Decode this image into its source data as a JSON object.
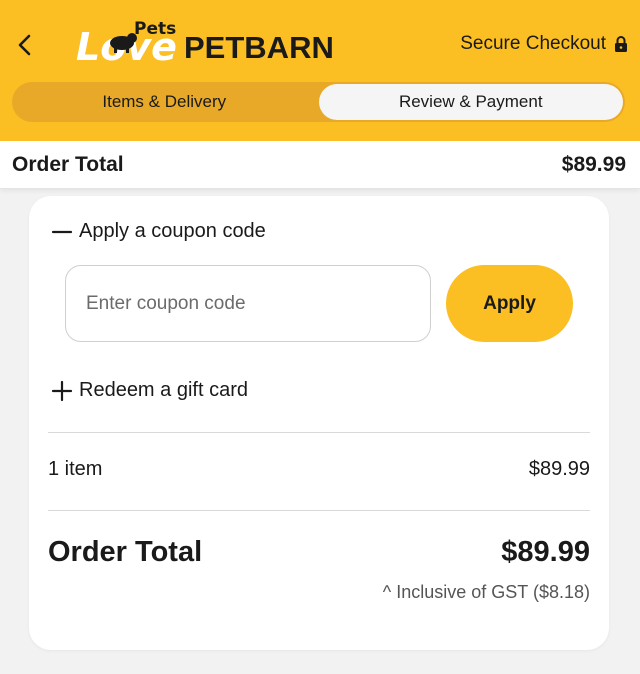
{
  "header": {
    "logo_small": "Pets",
    "logo_love": "Love",
    "logo_brand": "PETBARN",
    "secure_label": "Secure Checkout",
    "back_icon": "chevron-left-icon",
    "lock_icon": "lock-icon"
  },
  "tabs": [
    {
      "label": "Items & Delivery",
      "active": false
    },
    {
      "label": "Review & Payment",
      "active": true
    }
  ],
  "order_total_bar": {
    "label": "Order Total",
    "value": "$89.99"
  },
  "coupon": {
    "toggle_label": "Apply a coupon code",
    "placeholder": "Enter coupon code",
    "value": "",
    "apply_label": "Apply"
  },
  "gift_card": {
    "toggle_label": "Redeem a gift card"
  },
  "summary": {
    "items_label": "1 item",
    "items_value": "$89.99",
    "total_label": "Order Total",
    "total_value": "$89.99",
    "gst_note": "^ Inclusive of GST ($8.18)"
  },
  "colors": {
    "brand_yellow": "#fbbf24",
    "tab_track": "#e8a928",
    "text_dark": "#1a1a1a"
  }
}
